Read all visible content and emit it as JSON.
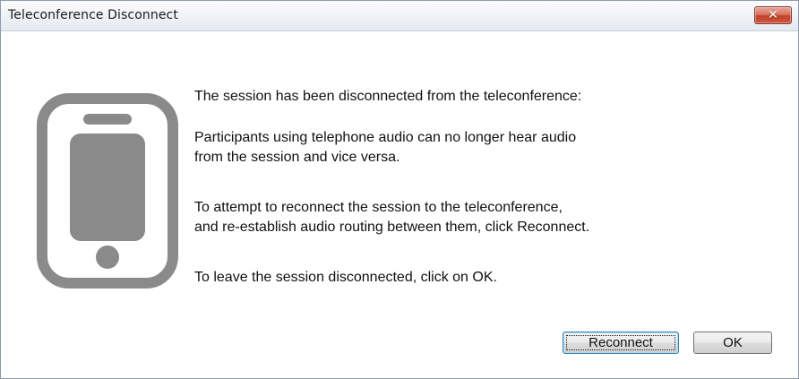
{
  "window": {
    "title": "Teleconference Disconnect",
    "close_label": "✕"
  },
  "icon": {
    "name": "phone-icon",
    "color": "#8a8a8a"
  },
  "message": {
    "paragraph1": "The session has been disconnected from the teleconference:",
    "paragraph2_line1": "Participants using telephone audio can no longer hear audio",
    "paragraph2_line2": "from the session and vice versa.",
    "paragraph3_line1": "To attempt to reconnect the session to the teleconference,",
    "paragraph3_line2": "and re-establish audio routing between them, click Reconnect.",
    "paragraph4": "To leave the session disconnected, click on OK."
  },
  "buttons": {
    "reconnect_label": "Reconnect",
    "ok_label": "OK"
  }
}
